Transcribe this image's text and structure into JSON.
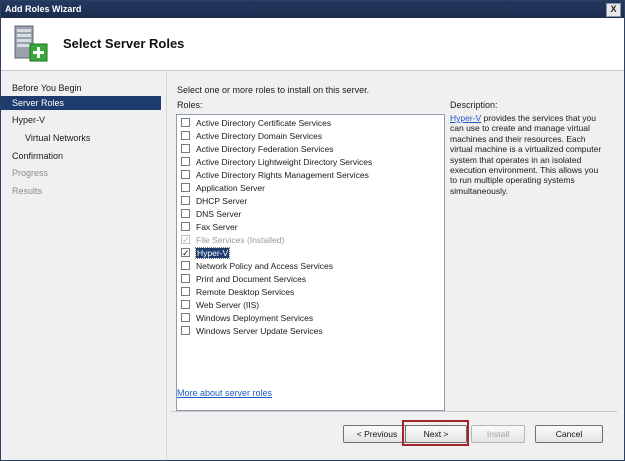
{
  "window": {
    "title": "Add Roles Wizard",
    "close_label": "X"
  },
  "header": {
    "title": "Select Server Roles",
    "icon": "server-add-icon"
  },
  "nav": {
    "items": [
      {
        "label": "Before You Begin",
        "state": "normal"
      },
      {
        "label": "Server Roles",
        "state": "active"
      },
      {
        "label": "Hyper-V",
        "state": "normal"
      },
      {
        "label": "Virtual Networks",
        "state": "sub"
      },
      {
        "label": "Confirmation",
        "state": "normal"
      },
      {
        "label": "Progress",
        "state": "disabled"
      },
      {
        "label": "Results",
        "state": "disabled"
      }
    ]
  },
  "main": {
    "instruction": "Select one or more roles to install on this server.",
    "roles_label": "Roles:",
    "roles": [
      {
        "label": "Active Directory Certificate Services",
        "checked": false,
        "disabled": false
      },
      {
        "label": "Active Directory Domain Services",
        "checked": false,
        "disabled": false
      },
      {
        "label": "Active Directory Federation Services",
        "checked": false,
        "disabled": false
      },
      {
        "label": "Active Directory Lightweight Directory Services",
        "checked": false,
        "disabled": false
      },
      {
        "label": "Active Directory Rights Management Services",
        "checked": false,
        "disabled": false
      },
      {
        "label": "Application Server",
        "checked": false,
        "disabled": false
      },
      {
        "label": "DHCP Server",
        "checked": false,
        "disabled": false
      },
      {
        "label": "DNS Server",
        "checked": false,
        "disabled": false
      },
      {
        "label": "Fax Server",
        "checked": false,
        "disabled": false
      },
      {
        "label": "File Services  (Installed)",
        "checked": true,
        "disabled": true
      },
      {
        "label": "Hyper-V",
        "checked": true,
        "disabled": false,
        "selected": true
      },
      {
        "label": "Network Policy and Access Services",
        "checked": false,
        "disabled": false
      },
      {
        "label": "Print and Document Services",
        "checked": false,
        "disabled": false
      },
      {
        "label": "Remote Desktop Services",
        "checked": false,
        "disabled": false
      },
      {
        "label": "Web Server (IIS)",
        "checked": false,
        "disabled": false
      },
      {
        "label": "Windows Deployment Services",
        "checked": false,
        "disabled": false
      },
      {
        "label": "Windows Server Update Services",
        "checked": false,
        "disabled": false
      }
    ],
    "description_label": "Description:",
    "description_link": "Hyper-V",
    "description_text": " provides the services that you can use to create and manage virtual machines and their resources. Each virtual machine is a virtualized computer system that operates in an isolated execution environment. This allows you to run multiple operating systems simultaneously.",
    "more_link": "More about server roles"
  },
  "buttons": {
    "previous": "< Previous",
    "next": "Next >",
    "install": "Install",
    "cancel": "Cancel"
  },
  "colors": {
    "titlebar": "#1f3358",
    "selection": "#1f3c6f",
    "link": "#1e5bc6",
    "highlight_box": "#a3222e"
  }
}
